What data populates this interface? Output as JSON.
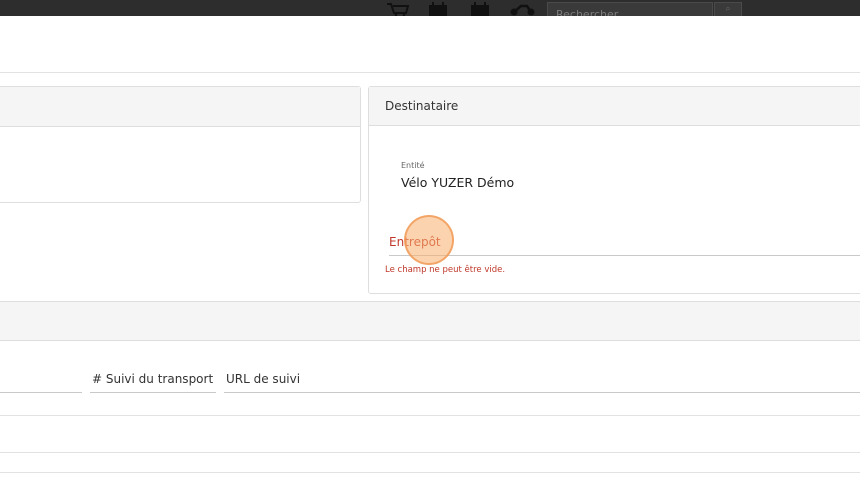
{
  "topbar": {
    "icons": [
      "cart-icon",
      "calendar-icon",
      "calendar-icon",
      "motorbike-icon"
    ],
    "search_placeholder": "Rechercher"
  },
  "destinataire": {
    "title": "Destinataire",
    "entity_label": "Entité",
    "entity_value": "Vélo YUZER Démo",
    "warehouse_label": "Entrepôt",
    "warehouse_error": "Le champ ne peut être vide."
  },
  "transport": {
    "tracking_label": "# Suivi du transport",
    "tracking_url_label": "URL de suivi"
  }
}
